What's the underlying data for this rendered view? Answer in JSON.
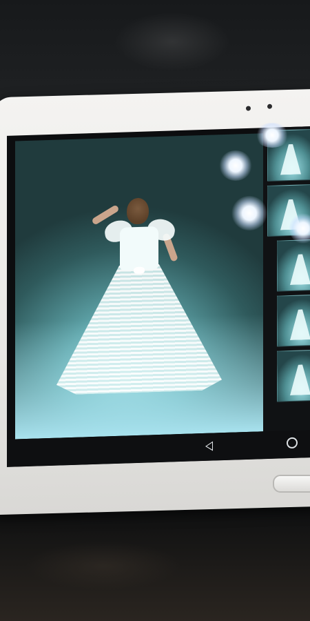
{
  "device": {
    "type": "tablet",
    "bezel_color": "#eceae7",
    "screen_color": "#0c0d0f"
  },
  "gallery": {
    "main_image": "wedding-gown-back-view",
    "background_color": "#5fa5aa",
    "thumbnails": [
      {
        "image": "gown-thumbnail-1"
      },
      {
        "image": "gown-thumbnail-2"
      },
      {
        "image": "gown-thumbnail-3"
      },
      {
        "image": "gown-thumbnail-4"
      },
      {
        "image": "gown-thumbnail-5"
      }
    ]
  },
  "navigation_bar": {
    "back_icon": "back-triangle-icon",
    "home_icon": "home-circle-icon",
    "icon_color": "#dfe3e6"
  },
  "hardware": {
    "home_key": "physical-home-button"
  }
}
